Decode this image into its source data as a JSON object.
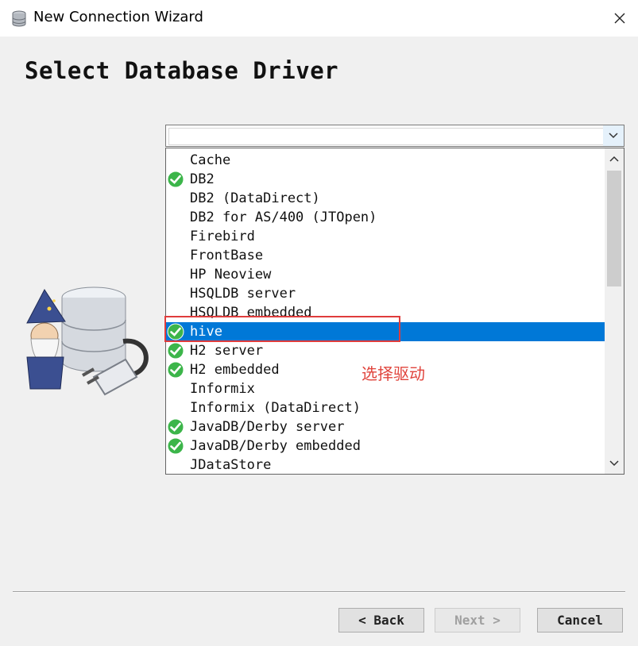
{
  "window": {
    "title": "New Connection Wizard",
    "icon": "database-icon",
    "close_icon": "close-icon"
  },
  "page": {
    "heading": "Select Database Driver"
  },
  "driver_combo": {
    "value": "",
    "arrow_icon": "chevron-down-icon"
  },
  "driver_list": {
    "selected": "hive",
    "items": [
      {
        "label": "Cache",
        "checked": false
      },
      {
        "label": "DB2",
        "checked": true
      },
      {
        "label": "DB2 (DataDirect)",
        "checked": false
      },
      {
        "label": "DB2 for AS/400 (JTOpen)",
        "checked": false
      },
      {
        "label": "Firebird",
        "checked": false
      },
      {
        "label": "FrontBase",
        "checked": false
      },
      {
        "label": "HP Neoview",
        "checked": false
      },
      {
        "label": "HSQLDB server",
        "checked": false
      },
      {
        "label": "HSQLDB embedded",
        "checked": false
      },
      {
        "label": "hive",
        "checked": true
      },
      {
        "label": "H2 server",
        "checked": true
      },
      {
        "label": "H2 embedded",
        "checked": true
      },
      {
        "label": "Informix",
        "checked": false
      },
      {
        "label": "Informix (DataDirect)",
        "checked": false
      },
      {
        "label": "JavaDB/Derby server",
        "checked": true
      },
      {
        "label": "JavaDB/Derby embedded",
        "checked": true
      },
      {
        "label": "JDataStore",
        "checked": false
      }
    ]
  },
  "annotation": {
    "text": "选择驱动",
    "color": "#e0443c"
  },
  "buttons": {
    "back": "< Back",
    "next": "Next >",
    "cancel": "Cancel"
  },
  "colors": {
    "selection": "#0078d7",
    "check": "#3cb54a"
  }
}
